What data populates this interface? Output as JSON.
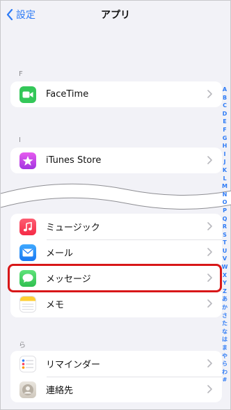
{
  "nav": {
    "back_label": "設定",
    "title": "アプリ"
  },
  "sections": {
    "f_header": "F",
    "i_header": "I",
    "ra_header": "ら"
  },
  "apps": {
    "facetime": "FaceTime",
    "itunes": "iTunes Store",
    "music": "ミュージック",
    "mail": "メール",
    "messages": "メッセージ",
    "notes": "メモ",
    "reminders": "リマインダー",
    "contacts": "連絡先"
  },
  "index_letters": [
    "A",
    "B",
    "C",
    "D",
    "E",
    "F",
    "G",
    "H",
    "I",
    "J",
    "K",
    "L",
    "M",
    "N",
    "O",
    "P",
    "Q",
    "R",
    "S",
    "T",
    "U",
    "V",
    "W",
    "X",
    "Y",
    "Z",
    "あ",
    "か",
    "さ",
    "た",
    "な",
    "は",
    "ま",
    "や",
    "ら",
    "わ",
    "#"
  ],
  "colors": {
    "accent": "#2f7cf6",
    "highlight": "#d81718",
    "facetime": "#34c759",
    "itunes": "#c343e8",
    "music": "#fa3c5a",
    "mail": "#2f8df5",
    "messages": "#34c759"
  }
}
